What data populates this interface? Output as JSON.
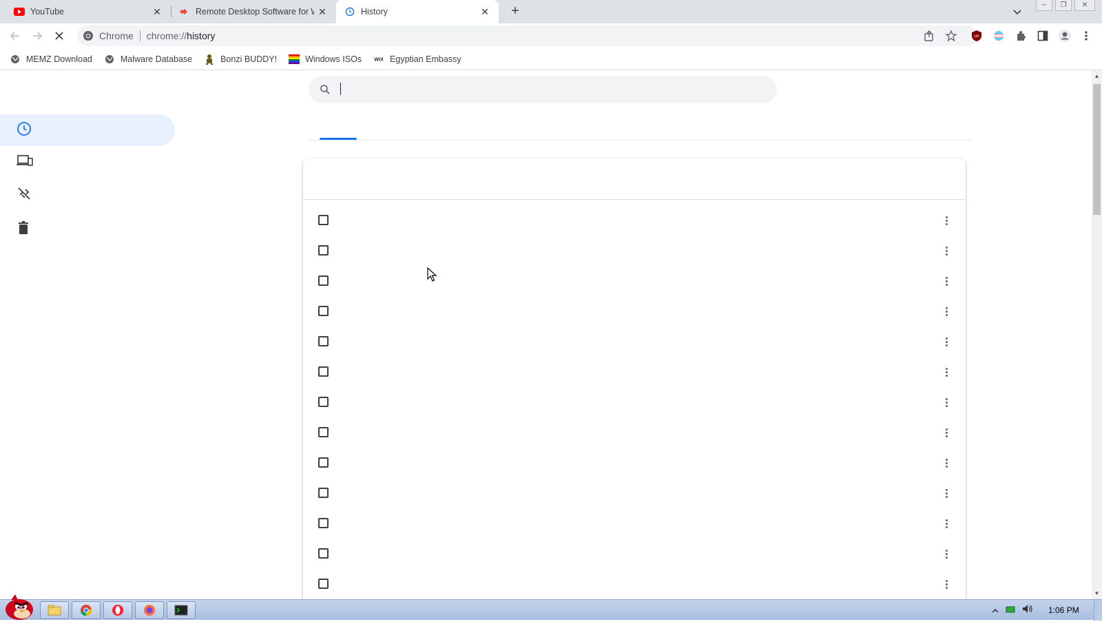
{
  "tabs": [
    {
      "title": "YouTube",
      "icon": "youtube-icon"
    },
    {
      "title": "Remote Desktop Software for Wi",
      "icon": "anydesk-icon"
    },
    {
      "title": "History",
      "icon": "history-favicon",
      "active": true
    }
  ],
  "omnibox": {
    "site_label": "Chrome",
    "url_prefix": "chrome://",
    "url_path": "history"
  },
  "bookmarks": [
    {
      "label": "MEMZ Download",
      "icon": "globe-icon"
    },
    {
      "label": "Malware Database",
      "icon": "globe-icon"
    },
    {
      "label": "Bonzi BUDDY!",
      "icon": "bonzi-icon"
    },
    {
      "label": "Windows ISOs",
      "icon": "rainbow-flag-icon"
    },
    {
      "label": "Egyptian Embassy",
      "icon": "wix-icon"
    }
  ],
  "search": {
    "placeholder": "",
    "value": ""
  },
  "sidebar": {
    "items": [
      {
        "name": "history",
        "icon": "clock-icon",
        "active": true
      },
      {
        "name": "tabs-from-other-devices",
        "icon": "devices-icon"
      },
      {
        "name": "clear-browsing-data-link",
        "icon": "link-off-icon"
      },
      {
        "name": "delete",
        "icon": "trash-icon"
      }
    ]
  },
  "history_rows": 13,
  "taskbar": {
    "time": "1:06 PM",
    "apps": [
      "explorer-icon",
      "chrome-icon",
      "opera-icon",
      "firefox-icon",
      "terminal-icon"
    ]
  },
  "colors": {
    "accent": "#1a73e8",
    "active_side": "#e8f0fe",
    "tab_strip": "#dee1e6"
  }
}
